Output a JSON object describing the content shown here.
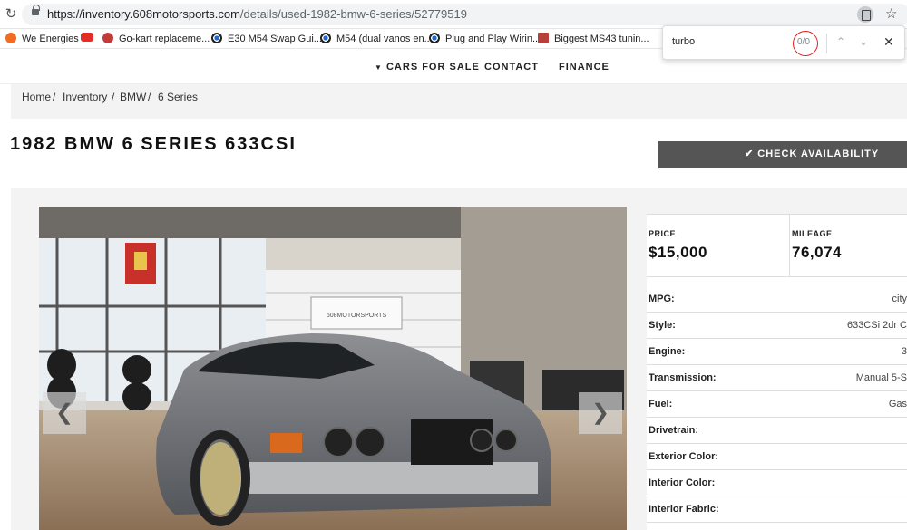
{
  "browser": {
    "url_host": "https://inventory.608motorsports.com",
    "url_path": "/details/used-1982-bmw-6-series/52779519",
    "bookmarks": [
      {
        "label": "We Energies",
        "icon": "we-energies-icon"
      },
      {
        "label": "",
        "icon": "youtube-icon"
      },
      {
        "label": "Go-kart replaceme...",
        "icon": "gokart-icon"
      },
      {
        "label": "E30 M54 Swap Gui...",
        "icon": "bmw-icon"
      },
      {
        "label": "M54 (dual vanos en...",
        "icon": "bmw-icon"
      },
      {
        "label": "Plug and Play Wirin...",
        "icon": "bmw-icon"
      },
      {
        "label": "Biggest MS43 tunin...",
        "icon": "ms-icon"
      }
    ],
    "find": {
      "query": "turbo",
      "count": "0/0"
    }
  },
  "nav": {
    "cars_for_sale": "CARS FOR SALE",
    "contact": "CONTACT",
    "finance": "FINANCE"
  },
  "breadcrumb": [
    "Home",
    "Inventory",
    "BMW",
    "6 Series"
  ],
  "vehicle": {
    "title": "1982 BMW 6 SERIES 633CSI",
    "check_label": "CHECK AVAILABILITY",
    "price_label": "PRICE",
    "price": "$15,000",
    "mileage_label": "MILEAGE",
    "mileage": "76,074",
    "specs": [
      {
        "label": "MPG:",
        "value": "city"
      },
      {
        "label": "Style:",
        "value": "633CSi 2dr C"
      },
      {
        "label": "Engine:",
        "value": "3"
      },
      {
        "label": "Transmission:",
        "value": "Manual 5-S"
      },
      {
        "label": "Fuel:",
        "value": "Gas"
      },
      {
        "label": "Drivetrain:",
        "value": ""
      },
      {
        "label": "Exterior Color:",
        "value": ""
      },
      {
        "label": "Interior Color:",
        "value": ""
      },
      {
        "label": "Interior Fabric:",
        "value": ""
      }
    ]
  },
  "photo": {
    "showroom_sign": "608MOTORSPORTS"
  }
}
